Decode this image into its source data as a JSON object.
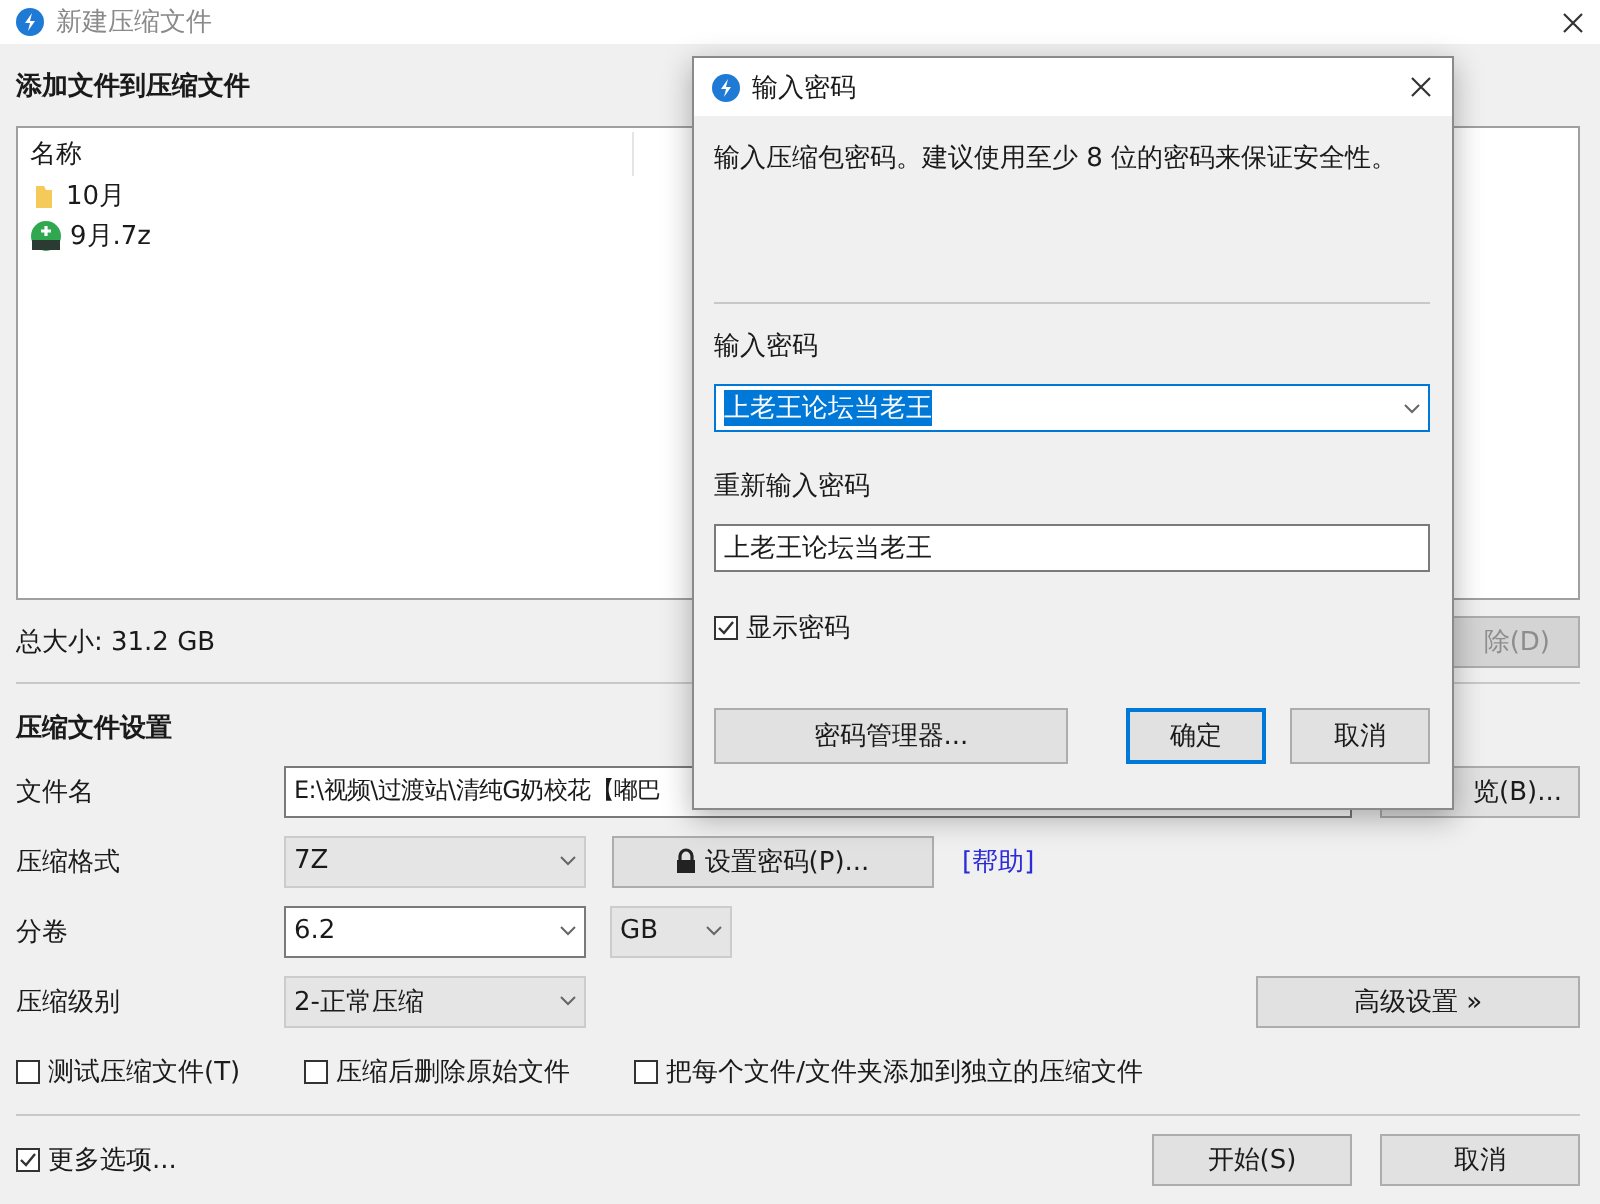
{
  "window": {
    "title": "新建压缩文件"
  },
  "files_section": {
    "heading": "添加文件到压缩文件",
    "column_1": "名称",
    "items": [
      {
        "kind": "folder",
        "name": "10月"
      },
      {
        "kind": "archive",
        "name": "9月.7z"
      }
    ],
    "total_size": "总大小: 31.2 GB",
    "delete_button": {
      "label": "除(D)",
      "disabled": true
    }
  },
  "settings": {
    "heading": "压缩文件设置",
    "filename": {
      "label": "文件名",
      "value": "E:\\视频\\过渡站\\清纯G奶校花【嘟巴",
      "browse_button": "览(B)..."
    },
    "format": {
      "label": "压缩格式",
      "value": "7Z",
      "password_button": "设置密码(P)...",
      "help_link": "[帮助]"
    },
    "split": {
      "label": "分卷",
      "value": "6.2",
      "unit": "GB"
    },
    "level": {
      "label": "压缩级别",
      "value": "2-正常压缩",
      "advanced_button": "高级设置 »"
    },
    "options": [
      {
        "label": "测试压缩文件(T)",
        "checked": false
      },
      {
        "label": "压缩后删除原始文件",
        "checked": false
      },
      {
        "label": "把每个文件/文件夹添加到独立的压缩文件",
        "checked": false
      }
    ]
  },
  "footer": {
    "more_options": {
      "label": "更多选项...",
      "checked": true
    },
    "buttons": [
      {
        "label": "开始(S)"
      },
      {
        "label": "取消"
      }
    ]
  },
  "dialog": {
    "title": "输入密码",
    "description": "输入压缩包密码。建议使用至少 8 位的密码来保证安全性。",
    "password_label": "输入密码",
    "password": "上老王论坛当老王",
    "password_text_selected": true,
    "confirm_label": "重新输入密码",
    "confirm_password": "上老王论坛当老王",
    "show_password": {
      "label": "显示密码",
      "checked": true
    },
    "buttons": [
      {
        "label": "密码管理器...",
        "default": false
      },
      {
        "label": "确定",
        "default": true
      },
      {
        "label": "取消",
        "default": false
      }
    ]
  }
}
